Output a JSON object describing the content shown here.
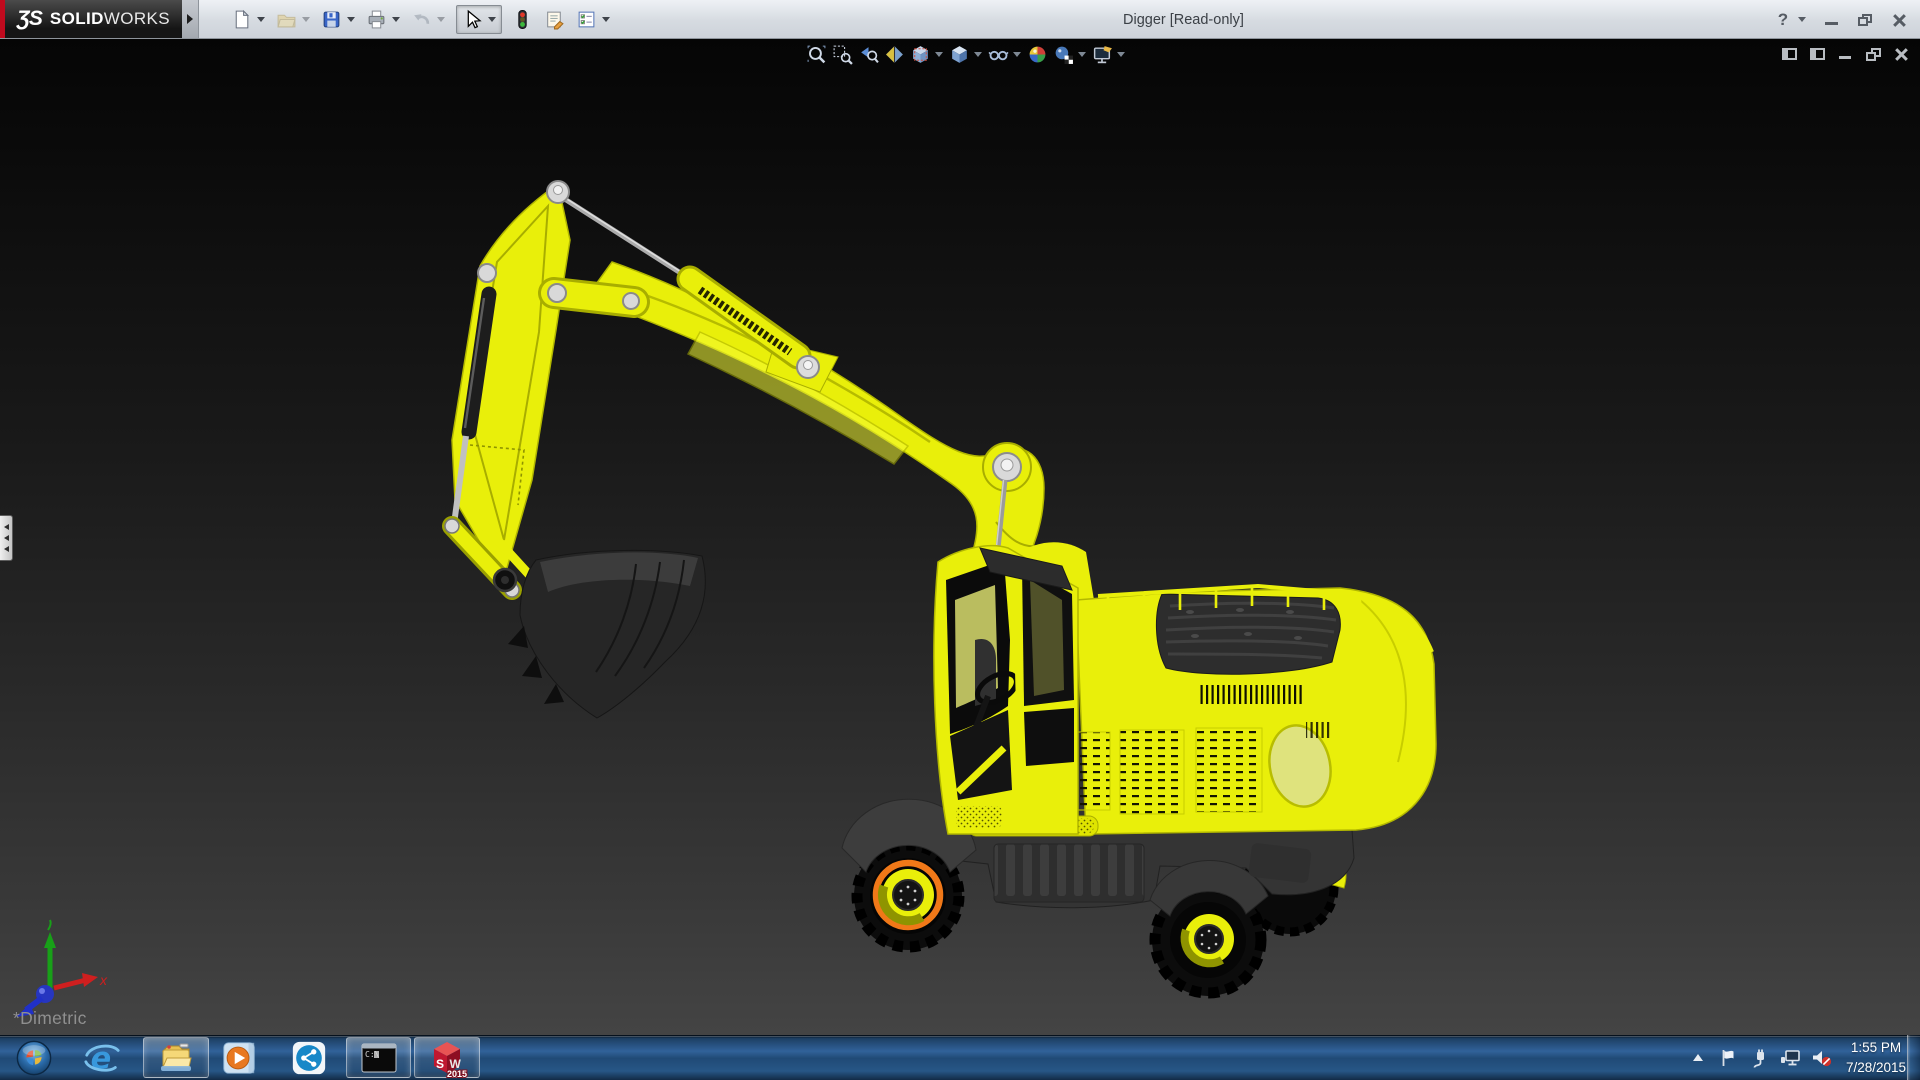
{
  "titlebar": {
    "logo": {
      "mark": "ƷS",
      "name_bold": "SOLID",
      "name_light": "WORKS"
    },
    "title": "Digger [Read-only]",
    "help_glyph": "?",
    "toolbar_items": [
      {
        "name": "new-document",
        "dropdown": true,
        "enabled": true
      },
      {
        "name": "open",
        "dropdown": true,
        "enabled": false
      },
      {
        "name": "save",
        "dropdown": true,
        "enabled": true
      },
      {
        "name": "print",
        "dropdown": true,
        "enabled": true
      },
      {
        "name": "undo",
        "dropdown": true,
        "enabled": false
      },
      {
        "name": "select",
        "dropdown": true,
        "enabled": true,
        "pressed": true
      },
      {
        "name": "rebuild-traffic-light",
        "dropdown": false,
        "enabled": true
      },
      {
        "name": "file-properties",
        "dropdown": false,
        "enabled": true
      },
      {
        "name": "options",
        "dropdown": true,
        "enabled": true
      }
    ],
    "window_controls": [
      "help",
      "minimize",
      "restore",
      "close"
    ]
  },
  "headsup_toolbar": {
    "items": [
      "zoom-to-fit",
      "zoom-to-area",
      "previous-view",
      "section-view",
      "view-orientation",
      "display-style",
      "hide-show-items",
      "edit-appearance",
      "apply-scene",
      "view-settings"
    ]
  },
  "viewport": {
    "document_controls": [
      "split-pane-left",
      "split-pane-right",
      "minimize",
      "restore",
      "close"
    ],
    "view_label": "*Dimetric",
    "triad_axis_label": "x",
    "model_subject": "yellow excavator digger"
  },
  "taskbar": {
    "apps": [
      {
        "name": "start-button",
        "open": false
      },
      {
        "name": "internet-explorer",
        "open": false
      },
      {
        "name": "windows-explorer",
        "open": true
      },
      {
        "name": "windows-media-player",
        "open": false
      },
      {
        "name": "sharing-app",
        "open": false
      },
      {
        "name": "command-prompt",
        "open": true,
        "glyph": "C:\\"
      },
      {
        "name": "solidworks-2015",
        "open": true,
        "letter_s": "S",
        "letter_w": "W",
        "year": "2015"
      }
    ],
    "tray": {
      "icons": [
        "show-hidden-icons",
        "action-center-flag",
        "power-plug",
        "network",
        "volume-muted"
      ],
      "time": "1:55 PM",
      "date": "7/28/2015"
    }
  },
  "colors": {
    "excavator_yellow": "#e9ef0a",
    "selection_orange": "#f07818",
    "titlebar_gray": "#d6dbe1",
    "taskbar_blue": "#2f5f94",
    "viewport_top": "#050505",
    "viewport_bottom": "#444444"
  }
}
